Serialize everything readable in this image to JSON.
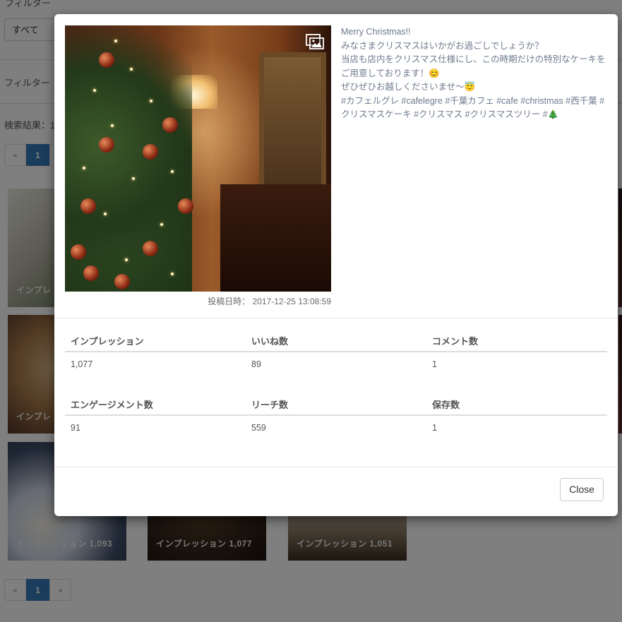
{
  "background": {
    "filter_label": "フィルター",
    "filter_select_value": "すべて",
    "filter2_label": "フィルター",
    "results_label": "検索結果：1",
    "pagination": {
      "prev": "«",
      "current": "1",
      "next": "»"
    },
    "thumbnails": [
      {
        "label": "インプレ"
      },
      {
        "label": "インプレ"
      },
      {
        "label": "インプレッション  1,093"
      },
      {
        "label": "インプレッション  1,077"
      },
      {
        "label": "インプレッション  1,051"
      }
    ]
  },
  "modal": {
    "photo_icon": "gallery-icon",
    "post_date": "投稿日時： 2017-12-25 13:08:59",
    "caption_lines": [
      "Merry Christmas!!",
      "みなさまクリスマスはいかがお過ごしでしょうか？",
      "当店も店内をクリスマス仕様にし、この時期だけの特別なケーキをご用意しております！😊",
      "ぜひぜひお越しくださいませ〜😇",
      "#カフェルグレ #cafelegre #千葉カフェ #cafe #christmas #西千葉 #クリスマスケーキ #クリスマス #クリスマスツリー #🎄"
    ],
    "stats_row1": {
      "headers": [
        "インプレッション",
        "いいね数",
        "コメント数"
      ],
      "values": [
        "1,077",
        "89",
        "1"
      ]
    },
    "stats_row2": {
      "headers": [
        "エンゲージメント数",
        "リーチ数",
        "保存数"
      ],
      "values": [
        "91",
        "559",
        "1"
      ]
    },
    "close_label": "Close"
  },
  "colors": {
    "overlay": "#00000080",
    "pagination_active": "#337ab7",
    "caption_text": "#6e7b8e"
  }
}
